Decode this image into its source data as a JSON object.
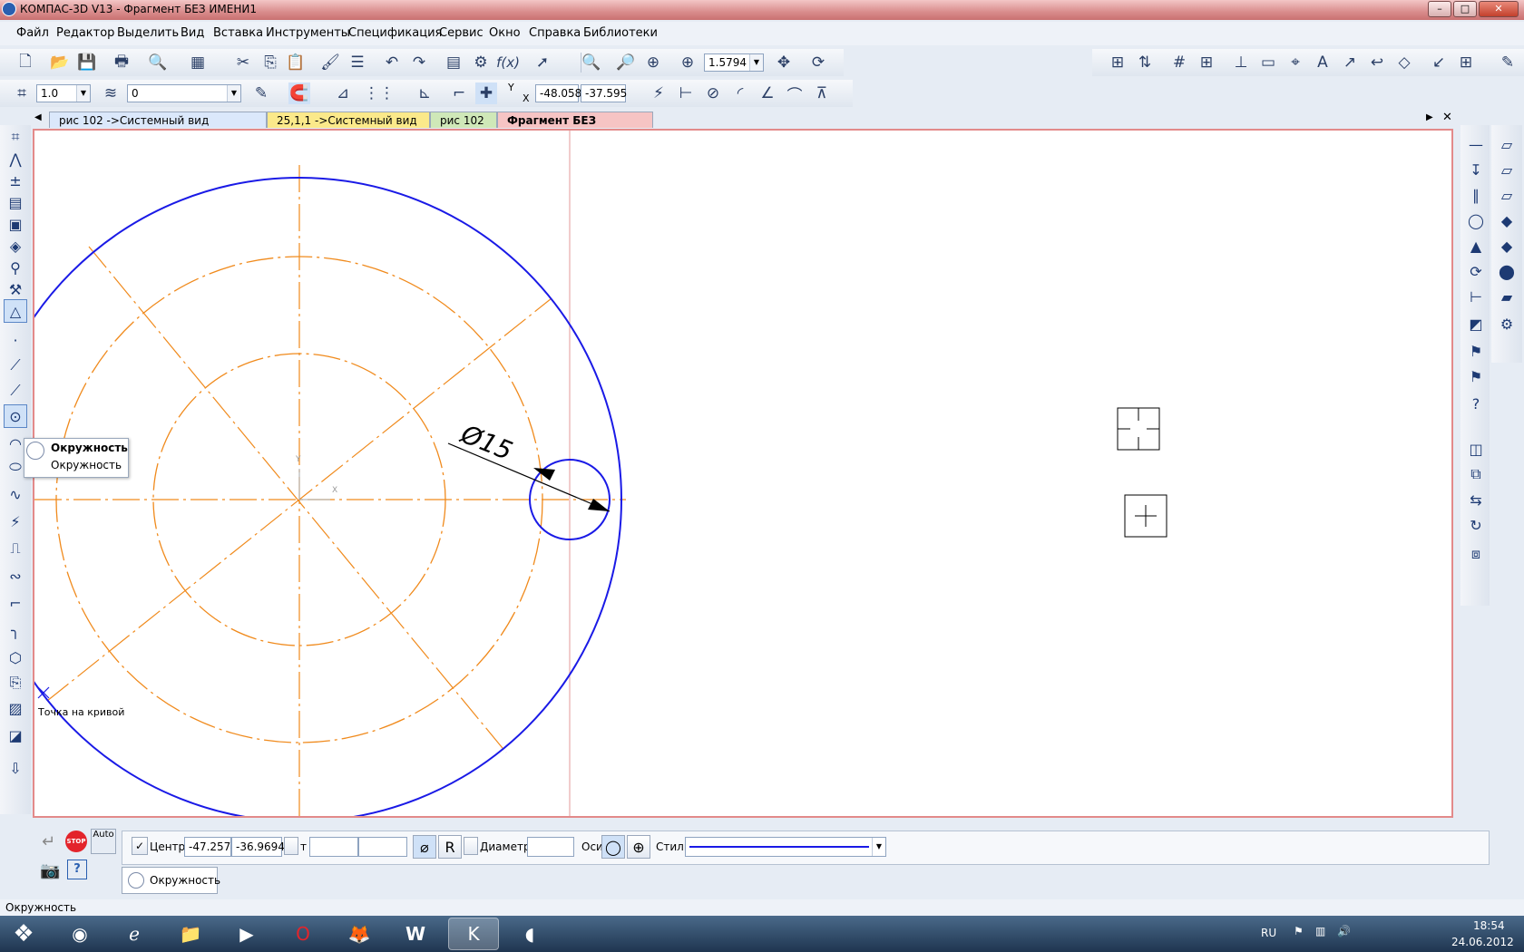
{
  "window": {
    "title": "КОМПАС-3D V13 - Фрагмент БЕЗ ИМЕНИ1"
  },
  "menu": [
    "Файл",
    "Редактор",
    "Выделить",
    "Вид",
    "Вставка",
    "Инструменты",
    "Спецификация",
    "Сервис",
    "Окно",
    "Справка",
    "Библиотеки"
  ],
  "toolbar": {
    "zoom_value": "1.5794",
    "line_step": "1.0",
    "layer": "0",
    "coord_x": "-48.058",
    "coord_y": "-37.595",
    "coord_label_y": "Y",
    "coord_label_x": "X"
  },
  "tabs": [
    {
      "label": "рис 102 ->Системный вид",
      "color": "#dbe8fb"
    },
    {
      "label": "25,1,1 ->Системный вид",
      "color": "#fbe98a"
    },
    {
      "label": "рис 102",
      "color": "#cfe8b8"
    },
    {
      "label": "Фрагмент БЕЗ ИМЕНИ1",
      "color": "#f6c4c4"
    }
  ],
  "drawing": {
    "dimension_text": "Ø15",
    "snap_label": "Точка на кривой",
    "axis_x_label": "X",
    "axis_y_label": "Y",
    "colors": {
      "contour": "#1a1ae6",
      "centerline": "#f08a1c",
      "guide": "#e39a9a",
      "frame": "#e38a8a"
    }
  },
  "popup": {
    "title": "Окружность",
    "subtitle": "Окружность"
  },
  "props": {
    "auto_label": "Auto",
    "stop_label": "STOP",
    "center_label": "Центр",
    "center_x": "-47.2574",
    "center_y": "-36.9694",
    "t_label": "т",
    "diameter_label": "Диаметр",
    "axes_label": "Оси",
    "style_label": "Стиль",
    "r_label": "R",
    "tab_label": "Окружность"
  },
  "status": {
    "text": "Окружность"
  },
  "tray": {
    "lang": "RU",
    "time": "18:54",
    "date": "24.06.2012"
  }
}
